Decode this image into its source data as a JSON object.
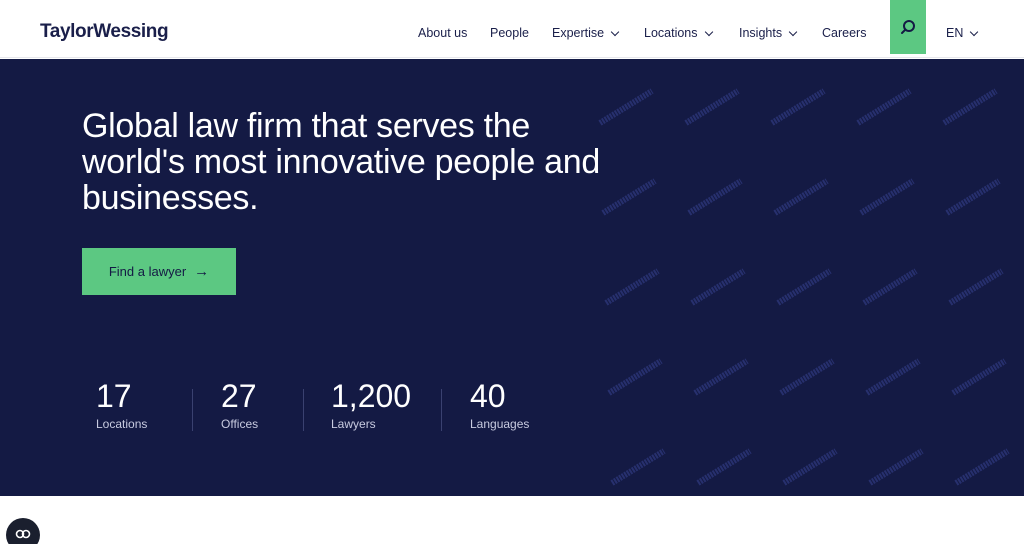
{
  "header": {
    "logo": "TaylorWessing",
    "nav": [
      {
        "label": "About us",
        "dropdown": false
      },
      {
        "label": "People",
        "dropdown": false
      },
      {
        "label": "Expertise",
        "dropdown": true
      },
      {
        "label": "Locations",
        "dropdown": true
      },
      {
        "label": "Insights",
        "dropdown": true
      },
      {
        "label": "Careers",
        "dropdown": false
      }
    ],
    "search_icon": "search-icon",
    "language": "EN"
  },
  "hero": {
    "headline": "Global law firm that serves the world's most innovative people and businesses.",
    "cta_label": "Find a lawyer",
    "cta_arrow": "→",
    "stats": [
      {
        "value": "17",
        "label": "Locations"
      },
      {
        "value": "27",
        "label": "Offices"
      },
      {
        "value": "1,200",
        "label": "Lawyers"
      },
      {
        "value": "40",
        "label": "Languages"
      }
    ]
  },
  "colors": {
    "navy": "#141a44",
    "green": "#5cc882",
    "text_dark": "#1a1f4a"
  }
}
